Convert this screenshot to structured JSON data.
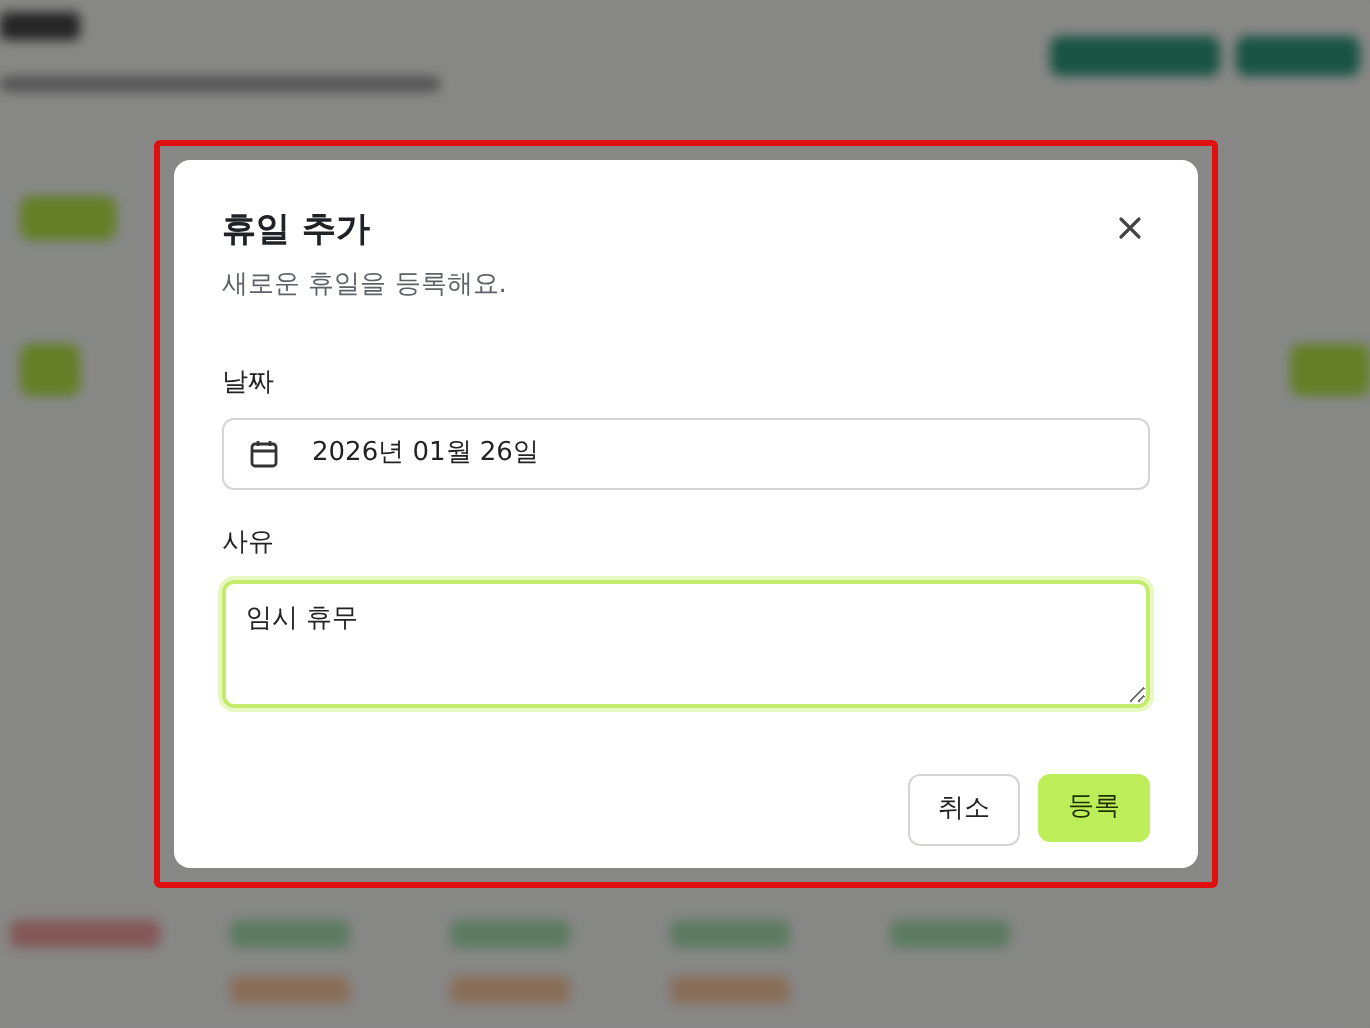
{
  "dialog": {
    "title": "휴일 추가",
    "subtitle": "새로운 휴일을 등록해요.",
    "highlighted": true,
    "fields": [
      {
        "kind": "date",
        "label": "날짜",
        "value": "2026년 01월 26일",
        "focused": false
      },
      {
        "kind": "textarea",
        "label": "사유",
        "value": "임시 휴무",
        "focused": true
      }
    ],
    "buttons": [
      {
        "kind": "secondary",
        "label": "취소"
      },
      {
        "kind": "primary",
        "label": "등록"
      }
    ]
  }
}
